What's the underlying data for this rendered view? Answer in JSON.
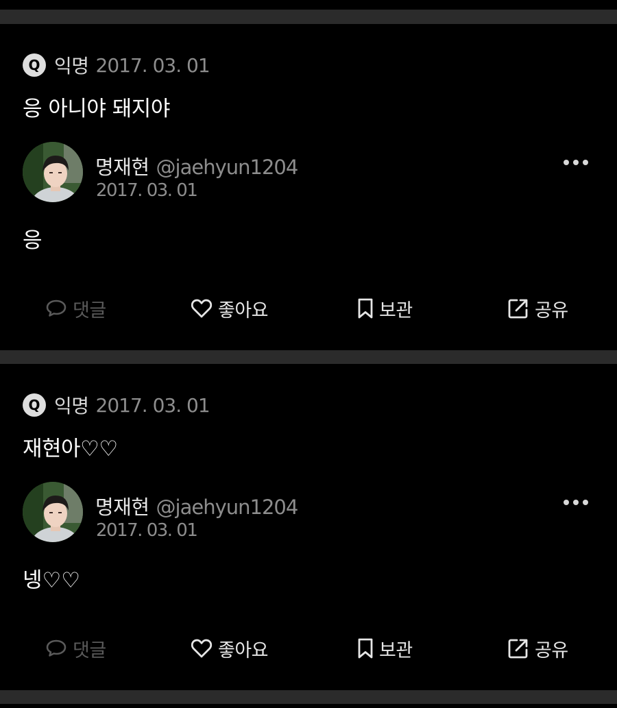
{
  "posts": [
    {
      "question": {
        "badge": "Q",
        "author": "익명",
        "date": "2017. 03. 01",
        "text": "응 아니야 돼지야"
      },
      "answer": {
        "name": "명재현",
        "handle": "@jaehyun1204",
        "date": "2017. 03. 01",
        "text": "응"
      },
      "actions": {
        "comment": "댓글",
        "like": "좋아요",
        "save": "보관",
        "share": "공유"
      }
    },
    {
      "question": {
        "badge": "Q",
        "author": "익명",
        "date": "2017. 03. 01",
        "text": "재현아♡♡"
      },
      "answer": {
        "name": "명재현",
        "handle": "@jaehyun1204",
        "date": "2017. 03. 01",
        "text": "넹♡♡"
      },
      "actions": {
        "comment": "댓글",
        "like": "좋아요",
        "save": "보관",
        "share": "공유"
      }
    }
  ],
  "icons": {
    "comment": "speech-bubble-icon",
    "like": "heart-outline-icon",
    "save": "bookmark-icon",
    "share": "external-share-icon",
    "more": "more-horizontal-icon"
  },
  "colors": {
    "background": "#000000",
    "separator": "#2b2b2b",
    "muted_text": "#8d8d8d",
    "disabled_action": "#5a5a5a"
  }
}
